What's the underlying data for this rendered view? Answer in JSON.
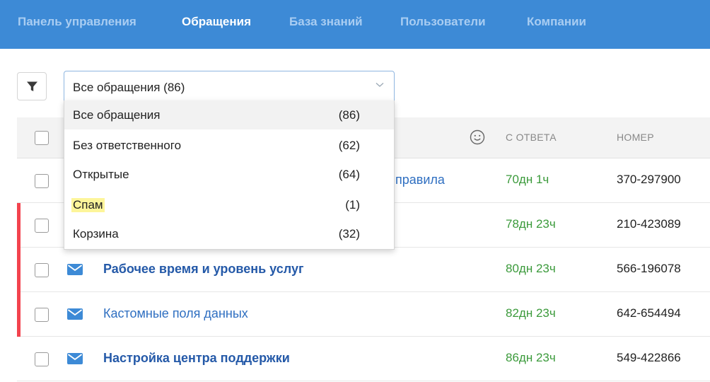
{
  "nav": {
    "items": [
      {
        "label": "Панель управления",
        "active": false
      },
      {
        "label": "Обращения",
        "active": true
      },
      {
        "label": "База знаний",
        "active": false
      },
      {
        "label": "Пользователи",
        "active": false
      },
      {
        "label": "Компании",
        "active": false
      }
    ]
  },
  "filter": {
    "icon": "filter-icon",
    "select_value": "Все обращения (86)",
    "options": [
      {
        "label": "Все обращения",
        "count": "(86)"
      },
      {
        "label": "Без ответственного",
        "count": "(62)"
      },
      {
        "label": "Открытые",
        "count": "(64)"
      },
      {
        "label": "Спам",
        "count": "(1)"
      },
      {
        "label": "Корзина",
        "count": "(32)"
      }
    ],
    "hovered_option": "Все обращения",
    "highlighted_option": "Спам"
  },
  "table": {
    "headers": {
      "since_reply": "С ОТВЕТА",
      "number": "НОМЕР"
    },
    "rows": [
      {
        "subject": "правила",
        "age": "70дн 1ч",
        "number": "370-297900"
      },
      {
        "subject": "",
        "age": "78дн 23ч",
        "number": "210-423089"
      },
      {
        "subject": "Рабочее время и уровень услуг",
        "age": "80дн 23ч",
        "number": "566-196078"
      },
      {
        "subject": "Кастомные поля данных",
        "age": "82дн 23ч",
        "number": "642-654494"
      },
      {
        "subject": "Настройка центра поддержки",
        "age": "86дн 23ч",
        "number": "549-422866"
      }
    ]
  },
  "colors": {
    "nav_bg": "#3d8ad6",
    "link": "#2f6fc1",
    "age_green": "#3b9a3b",
    "flag_red": "#f3434e",
    "highlight": "#fdf59a"
  }
}
